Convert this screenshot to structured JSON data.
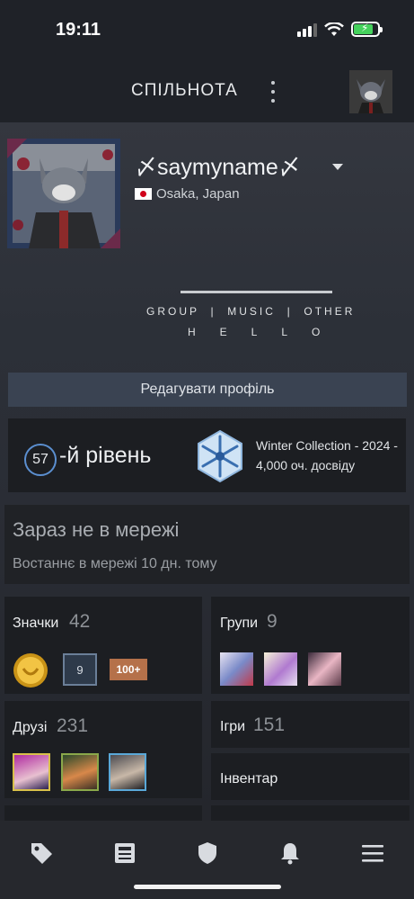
{
  "status_bar": {
    "time": "19:11"
  },
  "header": {
    "title": "СПІЛЬНОТА"
  },
  "profile": {
    "persona_name": "〆saymyname〆",
    "location": "Osaka, Japan",
    "summary_row1": "GROUP  |  MUSIC  |  OTHER",
    "summary_row2": "HELLO"
  },
  "edit_button": "Редагувати профіль",
  "level": {
    "number": "57",
    "label": "-й рівень",
    "badge_name": "Winter Collection - 2024 -",
    "badge_xp": "4,000 оч. досвіду"
  },
  "status": {
    "state": "Зараз не в мережі",
    "last_online": "Востаннє в мережі 10 дн. тому"
  },
  "tiles": {
    "badges": {
      "label": "Значки",
      "count": "42",
      "badge2_text": "9",
      "badge3_text": "100+"
    },
    "groups": {
      "label": "Групи",
      "count": "9"
    },
    "friends": {
      "label": "Друзі",
      "count": "231"
    },
    "games": {
      "label": "Ігри",
      "count": "151"
    },
    "inventory": {
      "label": "Інвентар"
    }
  },
  "colors": {
    "accent": "#5b8fd0",
    "button_bg": "#3a4352",
    "battery": "#45d15c"
  },
  "nav": {
    "items": [
      "tag-icon",
      "news-icon",
      "shield-icon",
      "bell-icon",
      "menu-icon"
    ]
  }
}
